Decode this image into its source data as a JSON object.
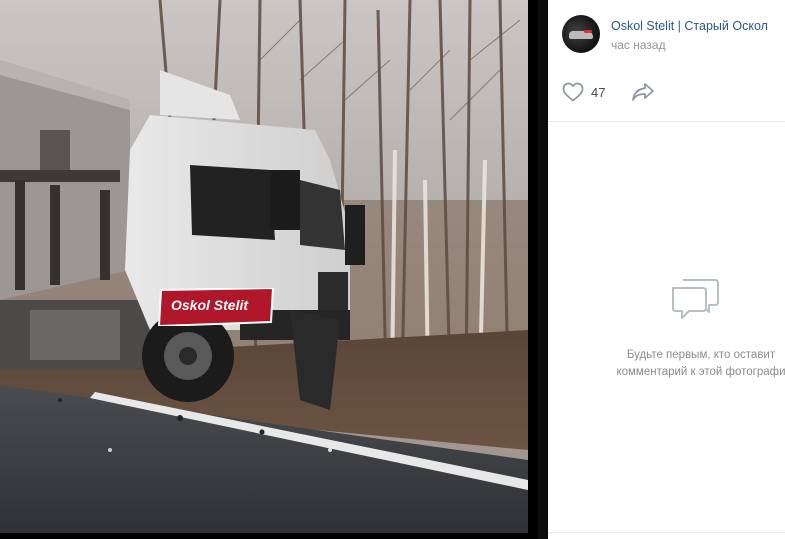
{
  "post": {
    "author": "Oskol Stelit | Старый Оскол",
    "time": "час назад",
    "likes": "47",
    "watermark": "Oskol Stelit"
  },
  "comments": {
    "empty_line1": "Будьте первым, кто оставит",
    "empty_line2": "комментарий к этой фотографи"
  },
  "icons": {
    "like": "heart-icon",
    "share": "share-arrow-icon",
    "empty": "comments-bubble-icon"
  },
  "colors": {
    "link": "#2a5885",
    "muted": "#939393",
    "watermark_bg": "#b0172a"
  }
}
